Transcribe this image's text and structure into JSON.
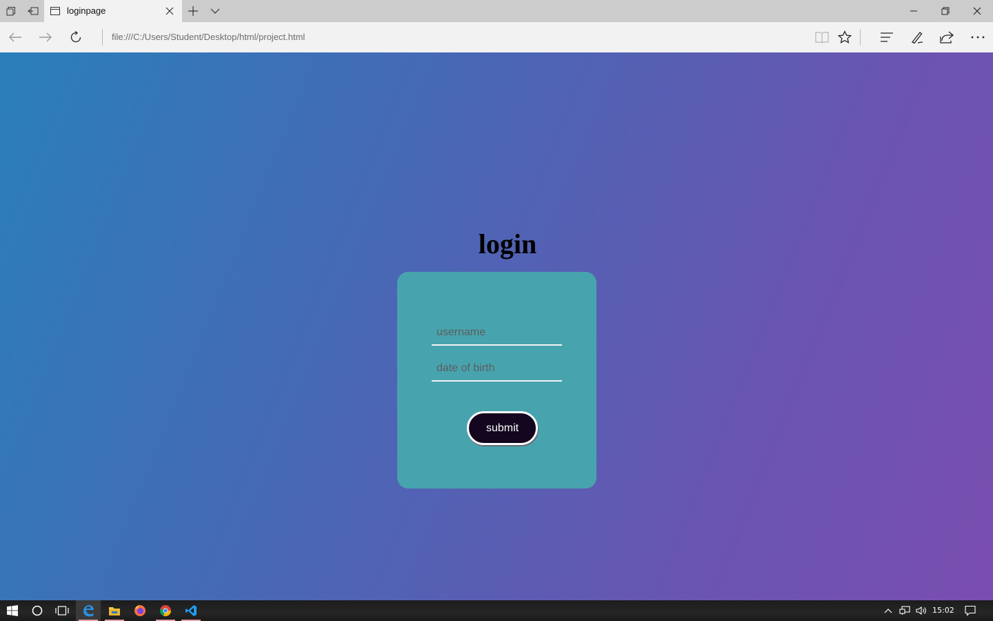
{
  "browser": {
    "tab": {
      "title": "loginpage"
    },
    "address_bar": {
      "url": "file:///C:/Users/Student/Desktop/html/project.html"
    }
  },
  "page": {
    "heading": "login",
    "form": {
      "username": {
        "value": "",
        "placeholder": "username"
      },
      "dob": {
        "value": "",
        "placeholder": "date of birth"
      },
      "submit_label": "submit"
    }
  },
  "taskbar": {
    "apps": [
      "edge-icon",
      "file-explorer-icon",
      "firefox-icon",
      "chrome-icon",
      "vscode-icon"
    ],
    "clock": "15:02"
  },
  "colors": {
    "gradient_start": "#2a7fba",
    "gradient_end": "#7a4eb0",
    "card": "#47a4ae",
    "button": "#13061e"
  }
}
